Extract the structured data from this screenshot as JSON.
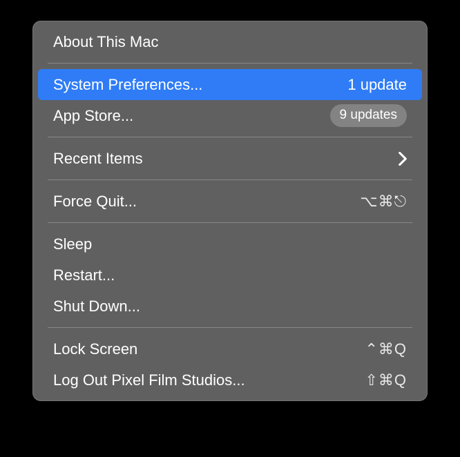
{
  "menu": {
    "about": {
      "label": "About This Mac"
    },
    "system_preferences": {
      "label": "System Preferences...",
      "badge": "1 update"
    },
    "app_store": {
      "label": "App Store...",
      "badge": "9 updates"
    },
    "recent_items": {
      "label": "Recent Items"
    },
    "force_quit": {
      "label": "Force Quit...",
      "shortcut": "⌥⌘⎋"
    },
    "sleep": {
      "label": "Sleep"
    },
    "restart": {
      "label": "Restart..."
    },
    "shut_down": {
      "label": "Shut Down..."
    },
    "lock_screen": {
      "label": "Lock Screen",
      "shortcut": "⌃⌘Q"
    },
    "log_out": {
      "label": "Log Out Pixel Film Studios...",
      "shortcut": "⇧⌘Q"
    }
  },
  "colors": {
    "selection": "#2f7cf6",
    "menu_bg": "rgba(128,128,128,0.75)"
  }
}
